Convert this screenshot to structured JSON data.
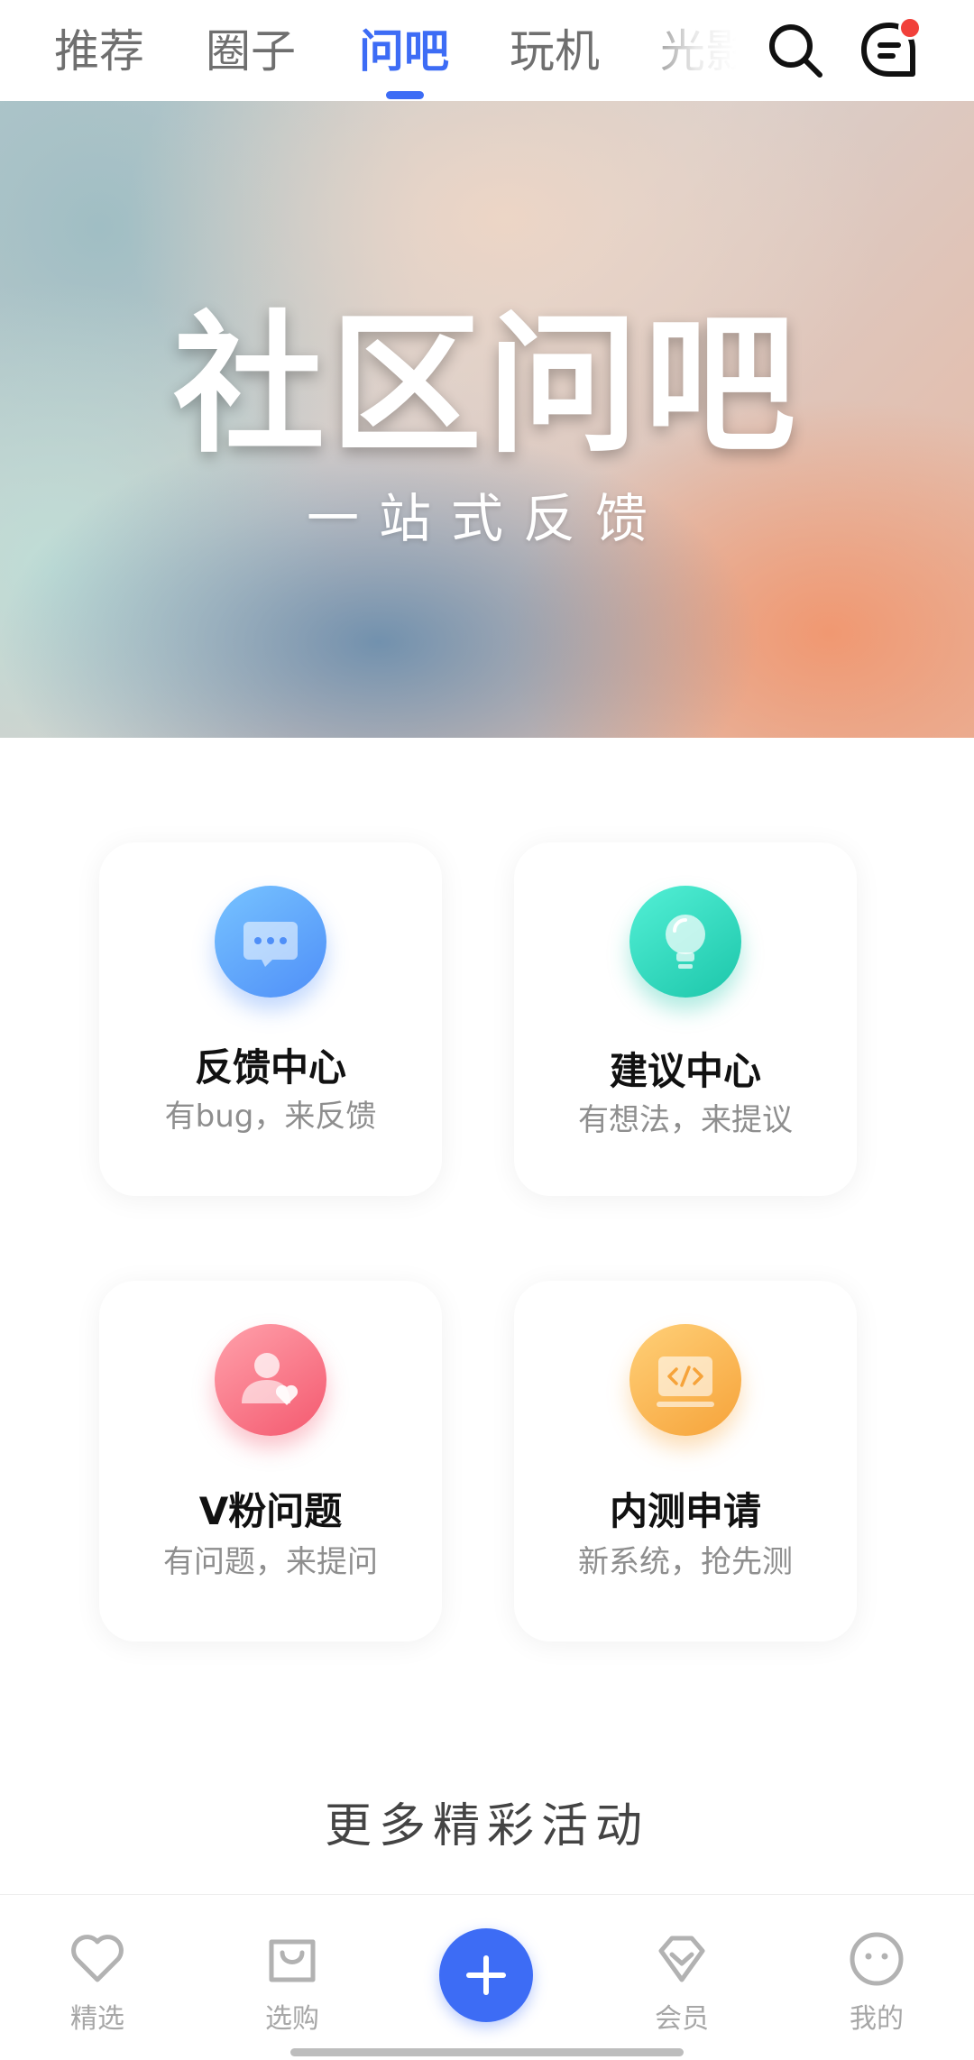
{
  "top_tabs": [
    {
      "label": "推荐"
    },
    {
      "label": "圈子"
    },
    {
      "label": "问吧",
      "active": true
    },
    {
      "label": "玩机"
    },
    {
      "label": "光影"
    }
  ],
  "icons": {
    "search": "search-icon",
    "messages": "chat-bubble-icon",
    "has_unread_badge": true
  },
  "hero": {
    "title": "社区问吧",
    "subtitle": "一站式反馈"
  },
  "cards": [
    {
      "title": "反馈中心",
      "subtitle": "有bug，来反馈",
      "icon": "chat-dots-icon",
      "color": "#4f8ff8"
    },
    {
      "title": "建议中心",
      "subtitle": "有想法，来提议",
      "icon": "lightbulb-icon",
      "color": "#1cc6aa"
    },
    {
      "title": "V粉问题",
      "subtitle": "有问题，来提问",
      "icon": "user-heart-icon",
      "color": "#f4596f"
    },
    {
      "title": "内测申请",
      "subtitle": "新系统，抢先测",
      "icon": "code-screen-icon",
      "color": "#f6a33a"
    }
  ],
  "more_section": {
    "title": "更多精彩活动"
  },
  "bottom_nav": [
    {
      "label": "精选",
      "icon": "heart-icon"
    },
    {
      "label": "选购",
      "icon": "shopping-bag-icon"
    },
    {
      "label": "",
      "icon": "plus-icon"
    },
    {
      "label": "会员",
      "icon": "diamond-heart-icon"
    },
    {
      "label": "我的",
      "icon": "face-icon"
    }
  ],
  "colors": {
    "accent": "#3d6cf5",
    "tab_inactive": "#6f6f6f",
    "badge": "#f1403a"
  }
}
